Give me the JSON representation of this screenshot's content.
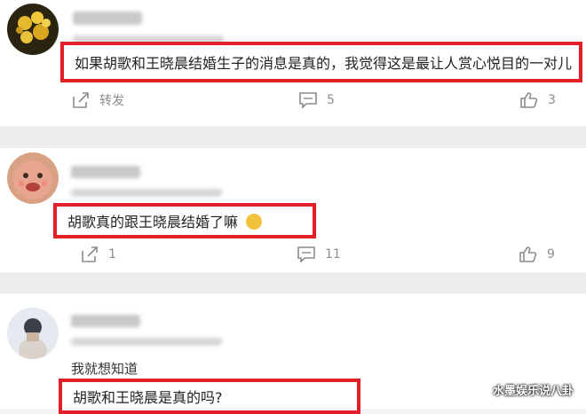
{
  "comments": [
    {
      "text": "如果胡歌和王晓晨结婚生子的消息是真的，我觉得这是最让人赏心悦目的一对儿",
      "repost_label": "转发",
      "comment_count": "5",
      "like_count": "3"
    },
    {
      "text": "胡歌真的跟王晓晨结婚了嘛",
      "repost_count": "1",
      "comment_count": "11",
      "like_count": "9"
    },
    {
      "plain_text": "我就想知道",
      "text": "胡歌和王晓晨是真的吗?"
    }
  ],
  "watermark": "水墨娱乐说八卦",
  "colors": {
    "highlight": "#e3202a",
    "icon": "#8c8c8c"
  }
}
